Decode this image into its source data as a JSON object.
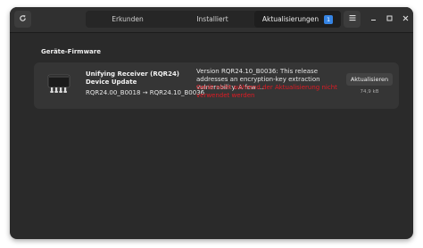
{
  "headerbar": {
    "tabs": [
      {
        "label": "Erkunden"
      },
      {
        "label": "Installiert"
      },
      {
        "label": "Aktualisierungen",
        "badge": "1"
      }
    ],
    "icons": {
      "refresh": "refresh-icon",
      "menu": "hamburger-menu-icon",
      "minimize": "minimize-icon",
      "maximize": "maximize-icon",
      "close": "close-icon"
    }
  },
  "section": {
    "title": "Geräte-Firmware"
  },
  "update_item": {
    "icon": "usb-receiver-chip-icon",
    "name": "Unifying Receiver (RQR24) Device Update",
    "version": "RQR24.00_B0018 → RQR24.10_B0036",
    "description": "Version RQR24.10_B0036: This release addresses an encryption-key extraction vulnerability.  A few …",
    "warning": "Gerät nicht während der Aktualisierung nicht verwendet werden",
    "button_label": "Aktualisieren",
    "size": "74,9 kB"
  },
  "colors": {
    "window_bg": "#2a2a2a",
    "card_bg": "#353535",
    "accent": "#3584e4",
    "warning": "#e01b24"
  }
}
